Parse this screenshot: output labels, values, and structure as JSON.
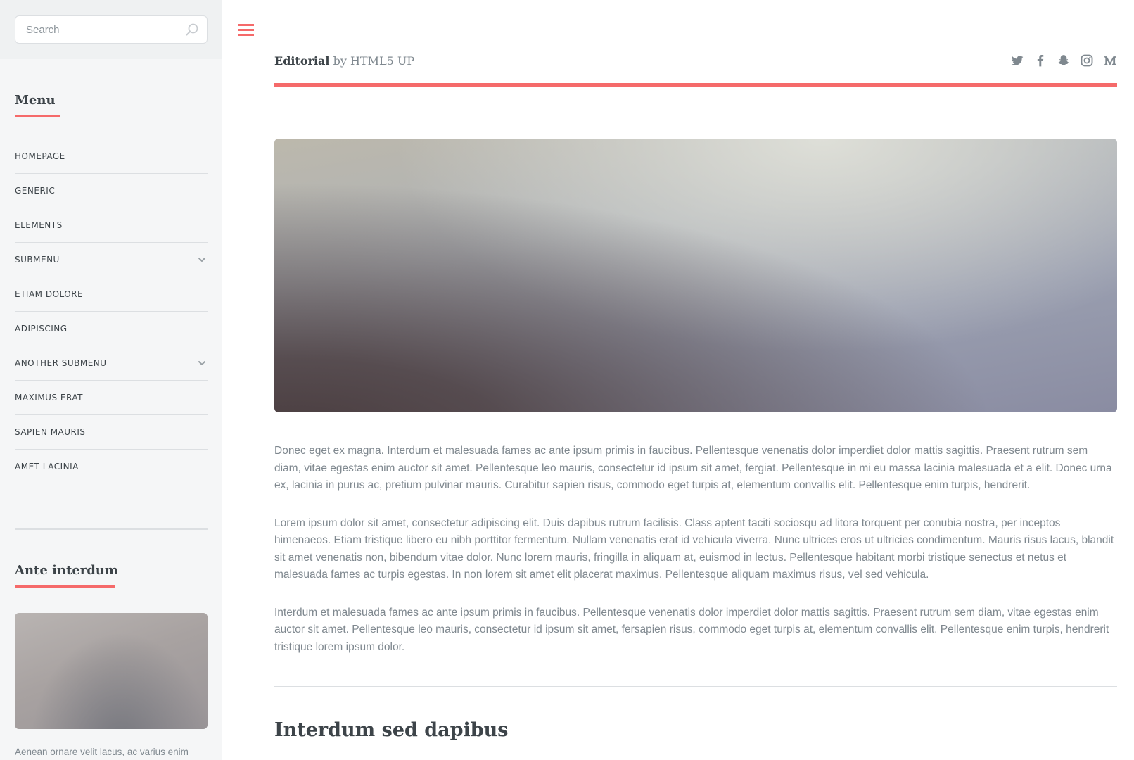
{
  "search": {
    "placeholder": "Search"
  },
  "sidebar": {
    "menu_title": "Menu",
    "menu_items": [
      {
        "label": "Homepage",
        "has_submenu": false
      },
      {
        "label": "Generic",
        "has_submenu": false
      },
      {
        "label": "Elements",
        "has_submenu": false
      },
      {
        "label": "Submenu",
        "has_submenu": true
      },
      {
        "label": "Etiam Dolore",
        "has_submenu": false
      },
      {
        "label": "Adipiscing",
        "has_submenu": false
      },
      {
        "label": "Another Submenu",
        "has_submenu": true
      },
      {
        "label": "Maximus Erat",
        "has_submenu": false
      },
      {
        "label": "Sapien Mauris",
        "has_submenu": false
      },
      {
        "label": "Amet Lacinia",
        "has_submenu": false
      }
    ],
    "ante_title": "Ante interdum",
    "ante_text": "Aenean ornare velit lacus, ac varius enim lorem ullamcorper dolore aliquam."
  },
  "header": {
    "logo_strong": "Editorial",
    "logo_rest": " by HTML5 UP",
    "socials": [
      "twitter-icon",
      "facebook-icon",
      "snapchat-icon",
      "instagram-icon",
      "medium-icon"
    ]
  },
  "main": {
    "paragraphs": [
      "Donec eget ex magna. Interdum et malesuada fames ac ante ipsum primis in faucibus. Pellentesque venenatis dolor imperdiet dolor mattis sagittis. Praesent rutrum sem diam, vitae egestas enim auctor sit amet. Pellentesque leo mauris, consectetur id ipsum sit amet, fergiat. Pellentesque in mi eu massa lacinia malesuada et a elit. Donec urna ex, lacinia in purus ac, pretium pulvinar mauris. Curabitur sapien risus, commodo eget turpis at, elementum convallis elit. Pellentesque enim turpis, hendrerit.",
      "Lorem ipsum dolor sit amet, consectetur adipiscing elit. Duis dapibus rutrum facilisis. Class aptent taciti sociosqu ad litora torquent per conubia nostra, per inceptos himenaeos. Etiam tristique libero eu nibh porttitor fermentum. Nullam venenatis erat id vehicula viverra. Nunc ultrices eros ut ultricies condimentum. Mauris risus lacus, blandit sit amet venenatis non, bibendum vitae dolor. Nunc lorem mauris, fringilla in aliquam at, euismod in lectus. Pellentesque habitant morbi tristique senectus et netus et malesuada fames ac turpis egestas. In non lorem sit amet elit placerat maximus. Pellentesque aliquam maximus risus, vel sed vehicula.",
      "Interdum et malesuada fames ac ante ipsum primis in faucibus. Pellentesque venenatis dolor imperdiet dolor mattis sagittis. Praesent rutrum sem diam, vitae egestas enim auctor sit amet. Pellentesque leo mauris, consectetur id ipsum sit amet, fersapien risus, commodo eget turpis at, elementum convallis elit. Pellentesque enim turpis, hendrerit tristique lorem ipsum dolor."
    ],
    "section_title": "Interdum sed dapibus"
  },
  "colors": {
    "accent": "#f56a6a",
    "heading": "#3d4449",
    "text": "#7f888f",
    "sidebar_bg": "#f5f6f7",
    "divider": "#dcdfe2"
  }
}
